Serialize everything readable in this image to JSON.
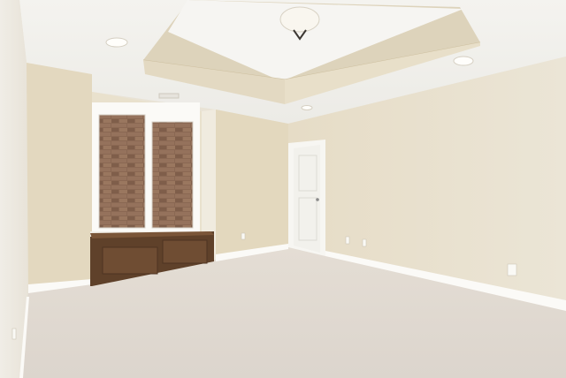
{
  "scene": {
    "kind": "empty-room-photo",
    "elements": [
      "tray-ceiling",
      "ceiling-light-fixture",
      "recessed-lights",
      "window",
      "window-seat-cabinet",
      "door",
      "carpet-floor",
      "baseboards",
      "outlets"
    ]
  },
  "colors": {
    "wall_light": "#ebe4d3",
    "wall_shadow": "#d8ceb8",
    "ceiling": "#f3f2ee",
    "carpet": "#e2dcd5",
    "wood": "#6b4a31",
    "brick": "#8c6a55",
    "trim": "#fbfaf7"
  }
}
